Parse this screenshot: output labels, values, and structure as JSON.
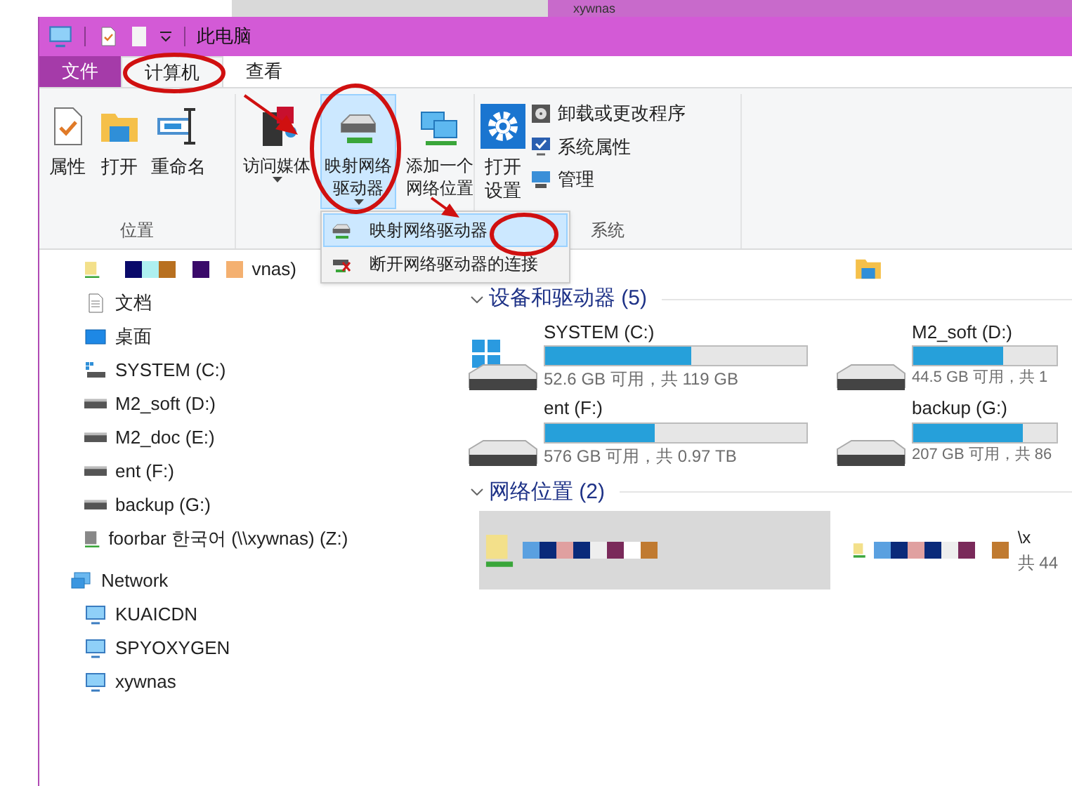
{
  "background_window": {
    "title": "xywnas"
  },
  "window": {
    "title": "此电脑"
  },
  "tabs": [
    {
      "label": "文件",
      "kind": "file",
      "selected": false
    },
    {
      "label": "计算机",
      "kind": "tab",
      "selected": true
    },
    {
      "label": "查看",
      "kind": "tab",
      "selected": false
    }
  ],
  "ribbon": {
    "groups": [
      {
        "label": "位置",
        "buttons": [
          {
            "label": "属性",
            "kind": "properties",
            "expanded": false
          },
          {
            "label": "打开",
            "kind": "open-folder",
            "expanded": false
          },
          {
            "label": "重命名",
            "kind": "rename",
            "expanded": false
          }
        ]
      },
      {
        "buttons": [
          {
            "label": "访问媒体",
            "kind": "media",
            "dropdown": true,
            "expanded": false
          },
          {
            "label": "映射网络驱动器",
            "kind": "map-drive",
            "dropdown": true,
            "expanded": true
          },
          {
            "label": "添加一个网络位置",
            "kind": "add-location",
            "dropdown": false,
            "expanded": false
          }
        ]
      },
      {
        "label": "系统",
        "buttons": [
          {
            "label": "打开设置",
            "kind": "settings",
            "expanded": false
          }
        ],
        "small_buttons": [
          {
            "label": "卸载或更改程序",
            "kind": "uninstall"
          },
          {
            "label": "系统属性",
            "kind": "system-properties"
          },
          {
            "label": "管理",
            "kind": "manage"
          }
        ]
      }
    ]
  },
  "dropdown_menu": [
    {
      "label": "映射网络驱动器",
      "kind": "map",
      "selected": true
    },
    {
      "label": "断开网络驱动器的连接",
      "kind": "disconnect",
      "selected": false
    }
  ],
  "nav": [
    {
      "label": "vnas)",
      "kind": "masked-share"
    },
    {
      "label": "文档",
      "kind": "documents"
    },
    {
      "label": "桌面",
      "kind": "desktop"
    },
    {
      "label": "SYSTEM (C:)",
      "kind": "system-drive"
    },
    {
      "label": "M2_soft (D:)",
      "kind": "drive"
    },
    {
      "label": "M2_doc (E:)",
      "kind": "drive"
    },
    {
      "label": "ent (F:)",
      "kind": "drive"
    },
    {
      "label": "backup (G:)",
      "kind": "drive"
    },
    {
      "label": "foorbar 한국어 (\\\\xywnas) (Z:)",
      "kind": "network-drive"
    },
    {
      "label": "Network",
      "kind": "network",
      "children": [
        {
          "label": "KUAICDN",
          "kind": "computer"
        },
        {
          "label": "SPYOXYGEN",
          "kind": "computer"
        },
        {
          "label": "xywnas",
          "kind": "computer"
        }
      ]
    }
  ],
  "devices": {
    "title": "设备和驱动器 (5)",
    "expanded": true,
    "drives": [
      {
        "name": "SYSTEM (C:)",
        "kind": "system",
        "level": 0.56,
        "info": "52.6 GB 可用，共 119 GB"
      },
      {
        "name": "M2_soft (D:)",
        "kind": "drive",
        "level": 0.63,
        "info": "44.5 GB 可用，共 1"
      },
      {
        "name": "ent (F:)",
        "kind": "drive",
        "level": 0.42,
        "info": "576 GB 可用，共 0.97 TB"
      },
      {
        "name": "backup (G:)",
        "kind": "drive",
        "level": 0.76,
        "info": "207 GB 可用，共 86"
      }
    ]
  },
  "network_locations": {
    "title": "网络位置 (2)",
    "expanded": true,
    "items": [
      {
        "kind": "masked",
        "selected": true
      },
      {
        "kind": "masked",
        "selected": false,
        "path": "\\x",
        "info": "共 44"
      }
    ]
  }
}
